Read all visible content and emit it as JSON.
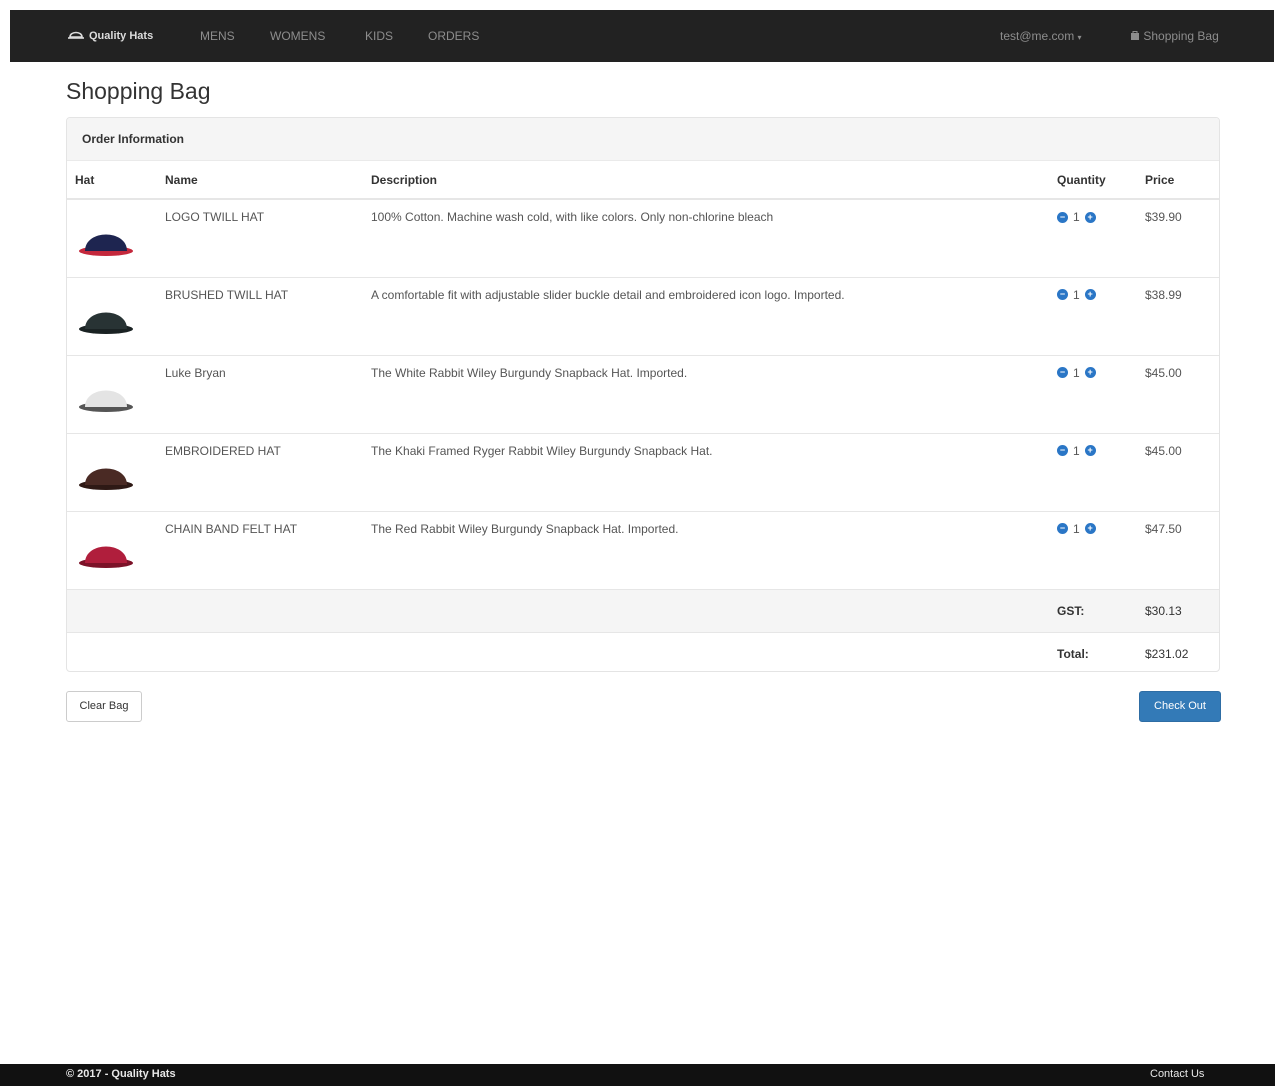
{
  "nav": {
    "brand": "Quality Hats",
    "links": [
      "MENS",
      "WOMENS",
      "KIDS",
      "ORDERS"
    ],
    "user_menu": "test@me.com",
    "bag_link": "Shopping Bag"
  },
  "page": {
    "title": "Shopping Bag"
  },
  "order": {
    "heading": "Order Information",
    "columns": {
      "hat": "Hat",
      "name": "Name",
      "description": "Description",
      "quantity": "Quantity",
      "price": "Price"
    },
    "items": [
      {
        "name": "LOGO TWILL HAT",
        "description": "100% Cotton. Machine wash cold, with like colors. Only non-chlorine bleach",
        "quantity": "1",
        "price": "$39.90",
        "hat_color": "#1e2550",
        "hat_accent": "#c4283c"
      },
      {
        "name": "BRUSHED TWILL HAT",
        "description": "A comfortable fit with adjustable slider buckle detail and embroidered icon logo. Imported.",
        "quantity": "1",
        "price": "$38.99",
        "hat_color": "#283334",
        "hat_accent": "#1a2223"
      },
      {
        "name": "Luke Bryan",
        "description": "The White Rabbit Wiley Burgundy Snapback Hat. Imported.",
        "quantity": "1",
        "price": "$45.00",
        "hat_color": "#e4e4e4",
        "hat_accent": "#555555"
      },
      {
        "name": "EMBROIDERED HAT",
        "description": "The Khaki Framed Ryger Rabbit Wiley Burgundy Snapback Hat.",
        "quantity": "1",
        "price": "$45.00",
        "hat_color": "#4a2a24",
        "hat_accent": "#2e1915"
      },
      {
        "name": "CHAIN BAND FELT HAT",
        "description": "The Red Rabbit Wiley Burgundy Snapback Hat. Imported.",
        "quantity": "1",
        "price": "$47.50",
        "hat_color": "#b01e3c",
        "hat_accent": "#7c1228"
      }
    ],
    "gst_label": "GST:",
    "gst_value": "$30.13",
    "total_label": "Total:",
    "total_value": "$231.02"
  },
  "actions": {
    "clear": "Clear Bag",
    "checkout": "Check Out"
  },
  "footer": {
    "copyright": "© 2017 - Quality Hats",
    "contact": "Contact Us"
  }
}
